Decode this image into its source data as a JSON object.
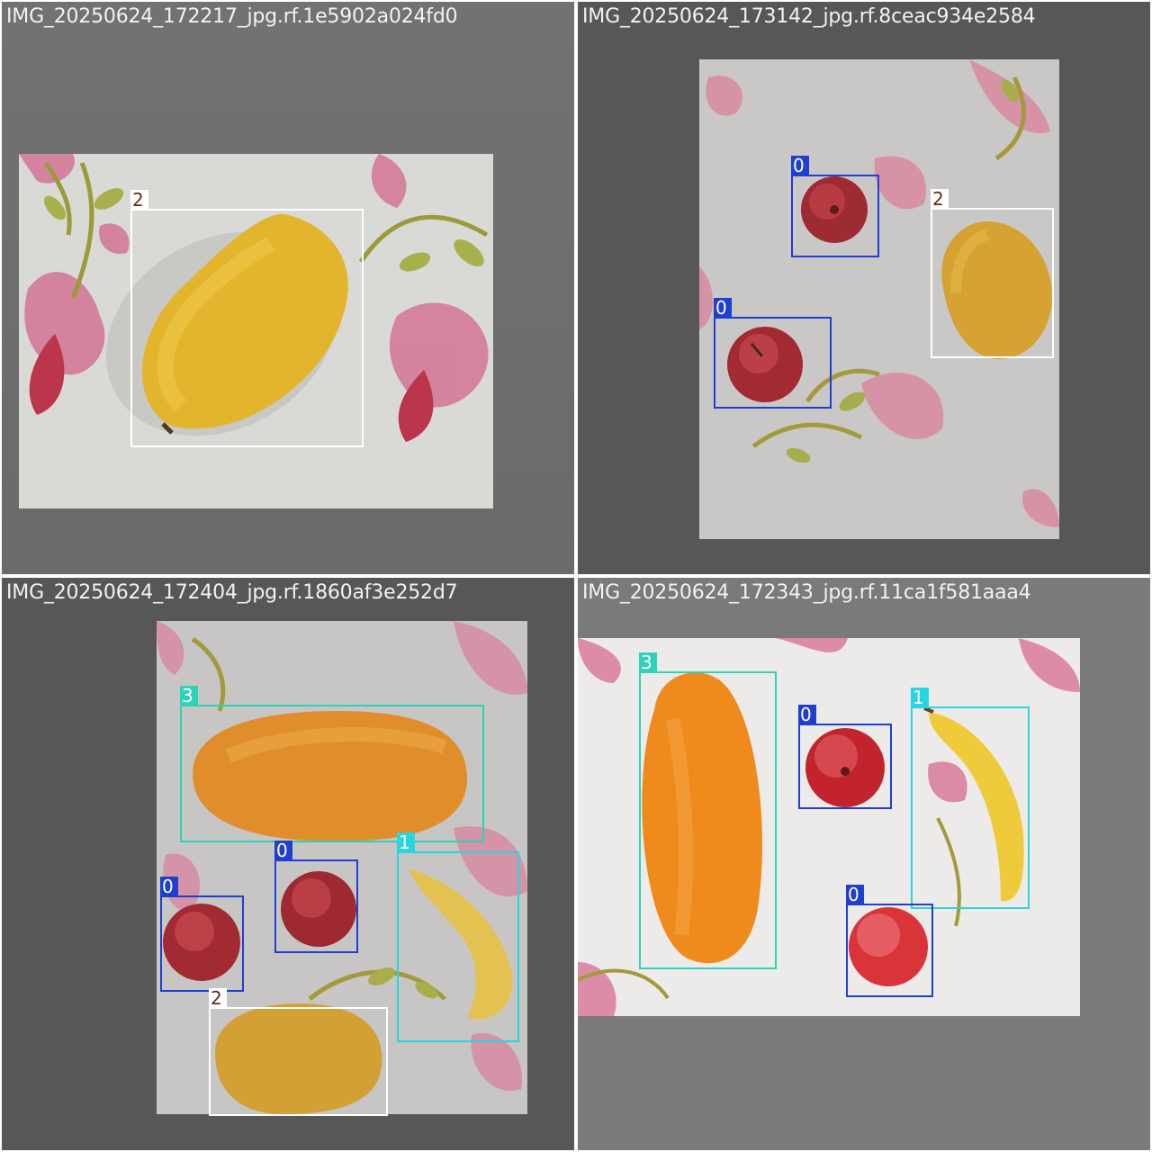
{
  "panels": [
    {
      "title": "IMG_20250624_172217_jpg.rf.1e5902a024fd0"
    },
    {
      "title": "IMG_20250624_173142_jpg.rf.8ceac934e2584"
    },
    {
      "title": "IMG_20250624_172404_jpg.rf.1860af3e252d7"
    },
    {
      "title": "IMG_20250624_172343_jpg.rf.11ca1f581aaa4"
    }
  ],
  "classes": {
    "0": {
      "label": "0",
      "box_color": "#1f3fd1",
      "tag_color": "#1f3fd1",
      "tag_text_color": "#ffffff"
    },
    "1": {
      "label": "1",
      "box_color": "#27d6e0",
      "tag_color": "#27d6e0",
      "tag_text_color": "#ffffff"
    },
    "2": {
      "label": "2",
      "box_color": "#ffffff",
      "tag_color": "#ffffff",
      "tag_text_color": "#6b2a17"
    },
    "3": {
      "label": "3",
      "box_color": "#2fd1b8",
      "tag_color": "#2fd1b8",
      "tag_text_color": "#ffffff"
    }
  },
  "colors": {
    "panel_background_light": "#7a7a7a",
    "panel_background_dark": "#565656",
    "divider": "#ffffff"
  }
}
